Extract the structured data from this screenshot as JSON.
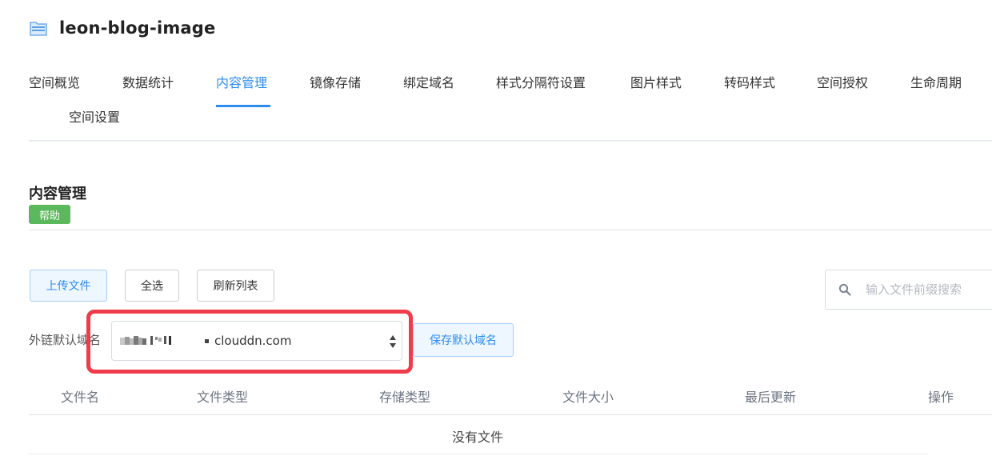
{
  "bucket": {
    "name": "leon-blog-image",
    "icon": "bucket-folder-icon"
  },
  "nav": {
    "tabs": [
      {
        "label": "空间概览"
      },
      {
        "label": "数据统计"
      },
      {
        "label": "内容管理",
        "active": true
      },
      {
        "label": "镜像存储"
      },
      {
        "label": "绑定域名"
      },
      {
        "label": "样式分隔符设置"
      },
      {
        "label": "图片样式"
      },
      {
        "label": "转码样式"
      },
      {
        "label": "空间授权"
      },
      {
        "label": "生命周期"
      },
      {
        "label": "空间设置"
      }
    ]
  },
  "section": {
    "title": "内容管理",
    "help_label": "帮助"
  },
  "toolbar": {
    "upload_label": "上传文件",
    "select_all_label": "全选",
    "refresh_label": "刷新列表",
    "search_placeholder": "输入文件前缀搜索"
  },
  "domain": {
    "label": "外链默认域名",
    "selected_value_visible": "clouddn.com",
    "save_label": "保存默认域名"
  },
  "table": {
    "columns": [
      "文件名",
      "文件类型",
      "存储类型",
      "文件大小",
      "最后更新",
      "操作"
    ],
    "empty_message": "没有文件"
  },
  "colors": {
    "accent": "#2d8cf0",
    "help_badge": "#5cb85c",
    "highlight": "#ef3b4a"
  }
}
